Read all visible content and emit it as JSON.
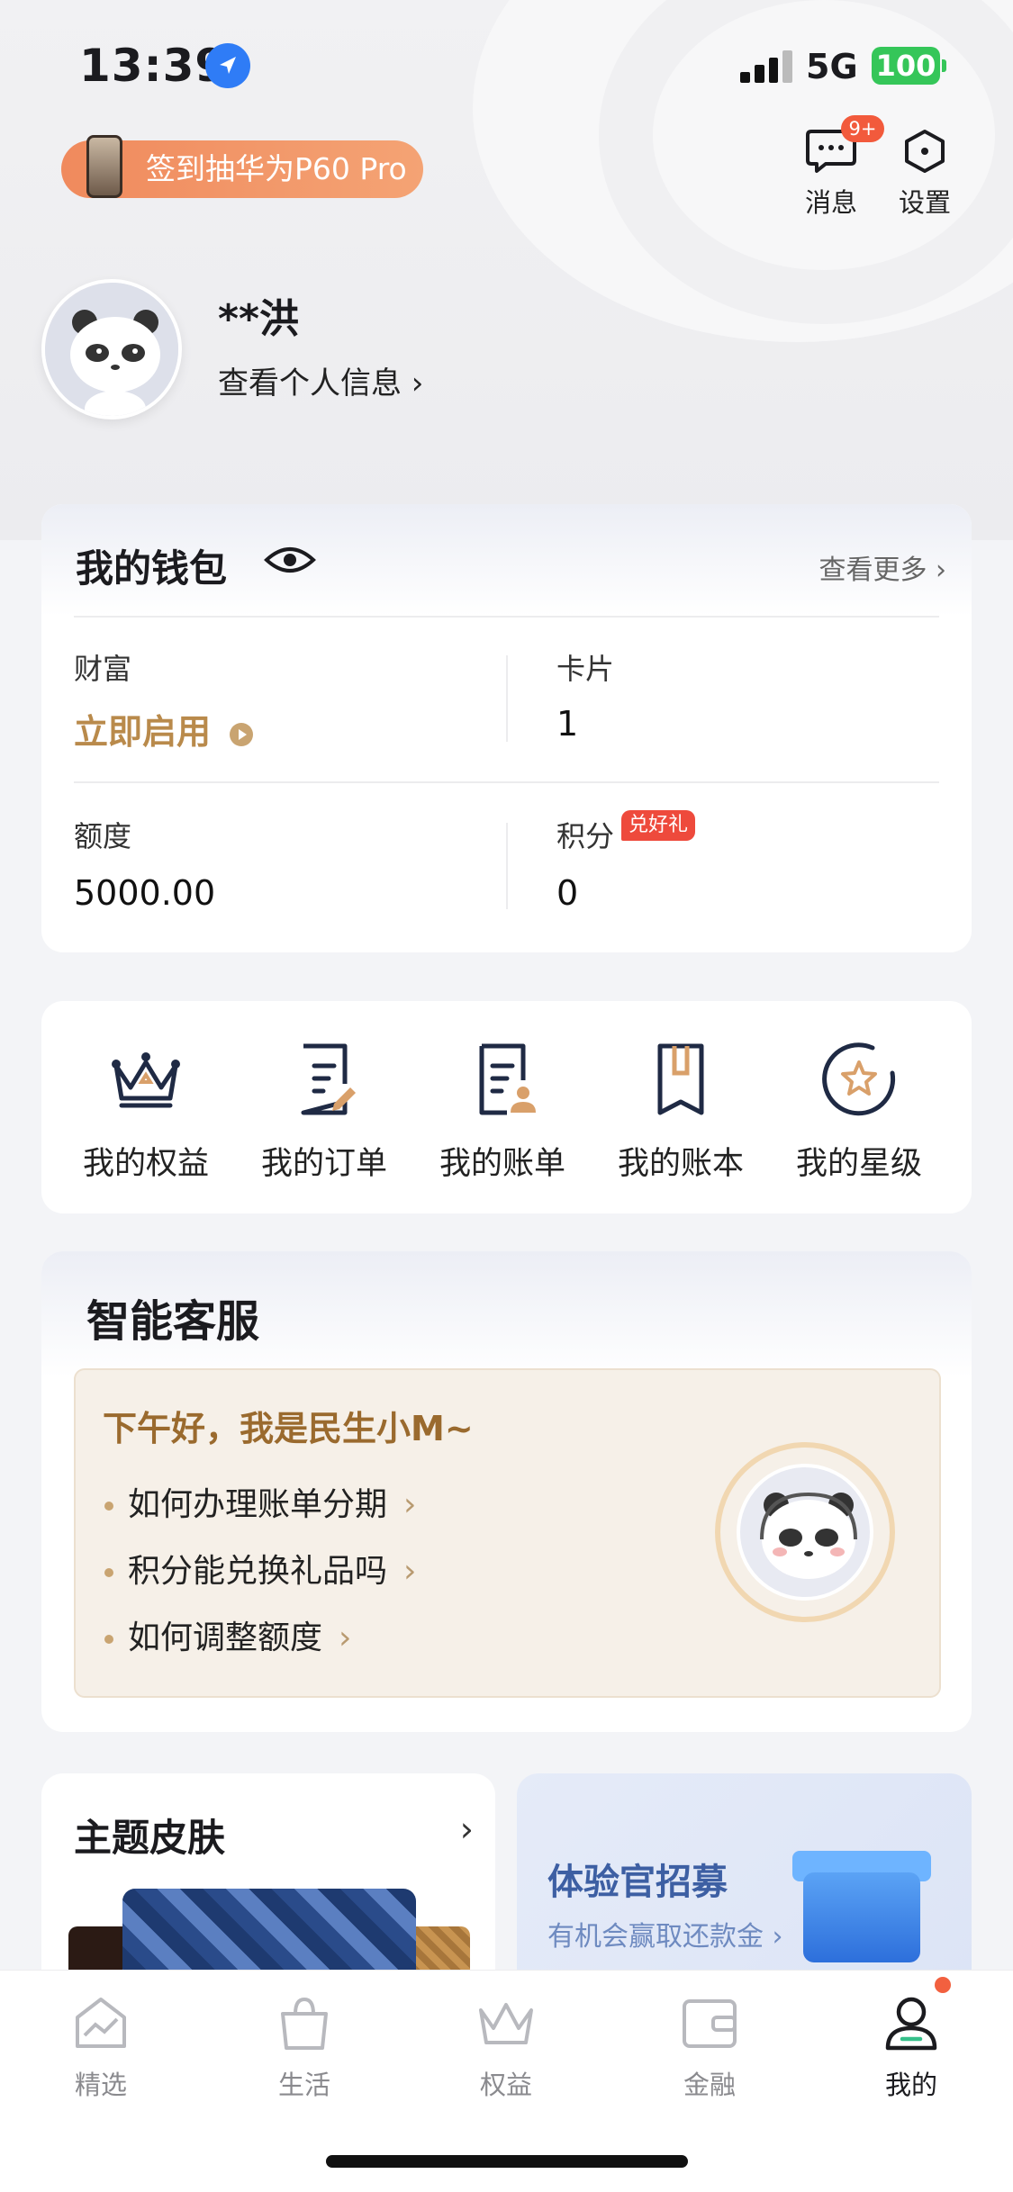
{
  "status_bar": {
    "time": "13:39",
    "network": "5G",
    "battery": "100"
  },
  "promo": {
    "label": "签到抽华为P60 Pro"
  },
  "top_actions": [
    {
      "label": "消息",
      "badge": "9+"
    },
    {
      "label": "设置"
    }
  ],
  "profile": {
    "name": "**洪",
    "link_label": "查看个人信息 ›"
  },
  "wallet": {
    "title": "我的钱包",
    "more_label": "查看更多 ›",
    "wealth": {
      "label": "财富",
      "value": "立即启用"
    },
    "cards": {
      "label": "卡片",
      "value": "1"
    },
    "limit": {
      "label": "额度",
      "value": "5000.00"
    },
    "points": {
      "label": "积分",
      "value": "0",
      "badge": "兑好礼"
    }
  },
  "shortcuts": [
    {
      "label": "我的权益",
      "icon": "crown-icon"
    },
    {
      "label": "我的订单",
      "icon": "order-icon"
    },
    {
      "label": "我的账单",
      "icon": "bill-icon"
    },
    {
      "label": "我的账本",
      "icon": "ledger-icon"
    },
    {
      "label": "我的星级",
      "icon": "star-level-icon"
    }
  ],
  "service": {
    "title": "智能客服",
    "greeting": "下午好，我是民生小M~",
    "questions": [
      "如何办理账单分期",
      "积分能兑换礼品吗",
      "如何调整额度"
    ]
  },
  "theme": {
    "title": "主题皮肤"
  },
  "recruit": {
    "title": "体验官招募",
    "subtitle": "有机会赢取还款金"
  },
  "tabbar": [
    {
      "label": "精选",
      "active": false
    },
    {
      "label": "生活",
      "active": false
    },
    {
      "label": "权益",
      "active": false
    },
    {
      "label": "金融",
      "active": false
    },
    {
      "label": "我的",
      "active": true
    }
  ],
  "colors": {
    "accent_gold": "#b98a4b",
    "promo_orange": "#f08a5d",
    "badge_red": "#ee4a3c",
    "battery_green": "#35c659"
  }
}
